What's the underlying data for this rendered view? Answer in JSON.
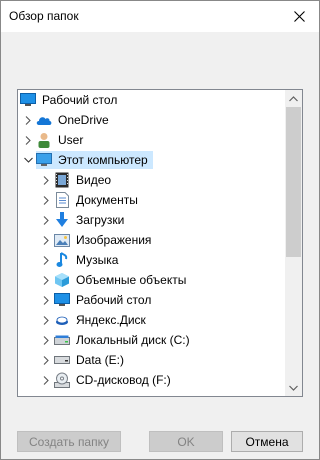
{
  "window": {
    "title": "Обзор папок"
  },
  "tree": {
    "items": [
      {
        "label": "Рабочий стол",
        "icon": "desktop-icon",
        "level": 0,
        "chevron": "none"
      },
      {
        "label": "OneDrive",
        "icon": "onedrive-icon",
        "level": 0,
        "chevron": "right"
      },
      {
        "label": "User",
        "icon": "user-icon",
        "level": 0,
        "chevron": "right"
      },
      {
        "label": "Этот компьютер",
        "icon": "this-pc-icon",
        "level": 0,
        "chevron": "down",
        "selected": true
      },
      {
        "label": "Видео",
        "icon": "video-icon",
        "level": 1,
        "chevron": "right"
      },
      {
        "label": "Документы",
        "icon": "documents-icon",
        "level": 1,
        "chevron": "right"
      },
      {
        "label": "Загрузки",
        "icon": "downloads-icon",
        "level": 1,
        "chevron": "right"
      },
      {
        "label": "Изображения",
        "icon": "pictures-icon",
        "level": 1,
        "chevron": "right"
      },
      {
        "label": "Музыка",
        "icon": "music-icon",
        "level": 1,
        "chevron": "right"
      },
      {
        "label": "Объемные объекты",
        "icon": "3d-objects-icon",
        "level": 1,
        "chevron": "right"
      },
      {
        "label": "Рабочий стол",
        "icon": "desktop-icon",
        "level": 1,
        "chevron": "right"
      },
      {
        "label": "Яндекс.Диск",
        "icon": "yandex-disk-icon",
        "level": 1,
        "chevron": "right"
      },
      {
        "label": "Локальный диск (C:)",
        "icon": "local-disk-icon",
        "level": 1,
        "chevron": "right"
      },
      {
        "label": "Data (E:)",
        "icon": "drive-icon",
        "level": 1,
        "chevron": "right"
      },
      {
        "label": "CD-дисковод (F:)",
        "icon": "cd-drive-icon",
        "level": 1,
        "chevron": "right"
      }
    ]
  },
  "buttons": {
    "new_folder": "Создать папку",
    "ok": "OK",
    "cancel": "Отмена"
  },
  "colors": {
    "selection": "#cce8ff",
    "border": "#828790"
  }
}
